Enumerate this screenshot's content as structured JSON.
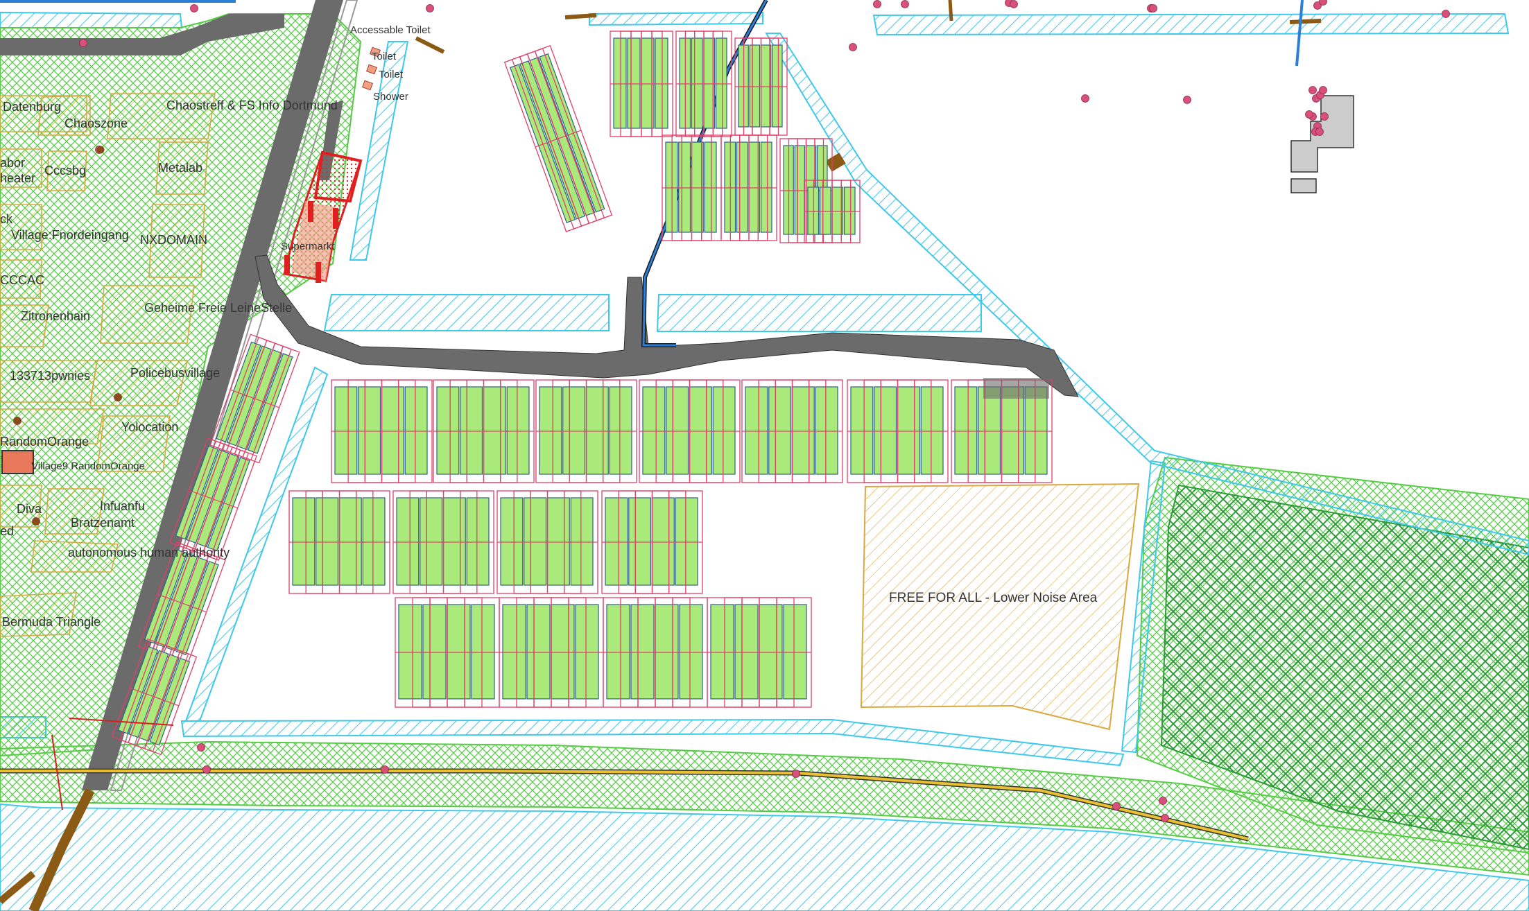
{
  "map": {
    "village_labels": {
      "datenburg": "Datenburg",
      "chaoszone": "Chaoszone",
      "chaostreff": "Chaostreff & FS Info Dortmund",
      "arbor": "abor",
      "theater": "heater",
      "cccsbg": "Cccsbg",
      "metalab": "Metalab",
      "ck": "ck",
      "fnordeingang": "Village:Fnordeingang",
      "nxdomain": "NXDOMAIN",
      "cccac": "CCCAC",
      "zitronenhain": "Zitronenhain",
      "geheime": "Geheime Freie LeineStelle",
      "pwnies": "133713pwnies",
      "policebus": "Policebusvillage",
      "yolocation": "Yolocation",
      "randomorange": "RandomOrange",
      "village9": "Village9 RandomOrange",
      "diva": "Diva",
      "infuanfu": "Infuanfu",
      "ed": "ed",
      "bratzenamt": "Bratzenamt",
      "autonomous": "autonomous human authority",
      "bermuda": "Bermuda Triangle",
      "supermarkt": "Supermarkt"
    },
    "facility_labels": {
      "accessible_toilet": "Accessable Toilet",
      "toilet1": "Toilet",
      "toilet2": "Toilet",
      "shower": "Shower"
    },
    "area_labels": {
      "free_for_all": "FREE FOR ALL - Lower Noise Area"
    },
    "colors": {
      "water": "#3ec8ea",
      "grass": "#55cc44",
      "forest": "#2a9b35",
      "road": "#6b6b6b",
      "tent_fill": "#aaea7a",
      "tent_border": "#2f5f88",
      "plot_border": "#e0406a",
      "camp_area": "#d9a840",
      "poi": "#d9507a",
      "path": "#8b5a14",
      "power": "#2a7fd6"
    }
  }
}
